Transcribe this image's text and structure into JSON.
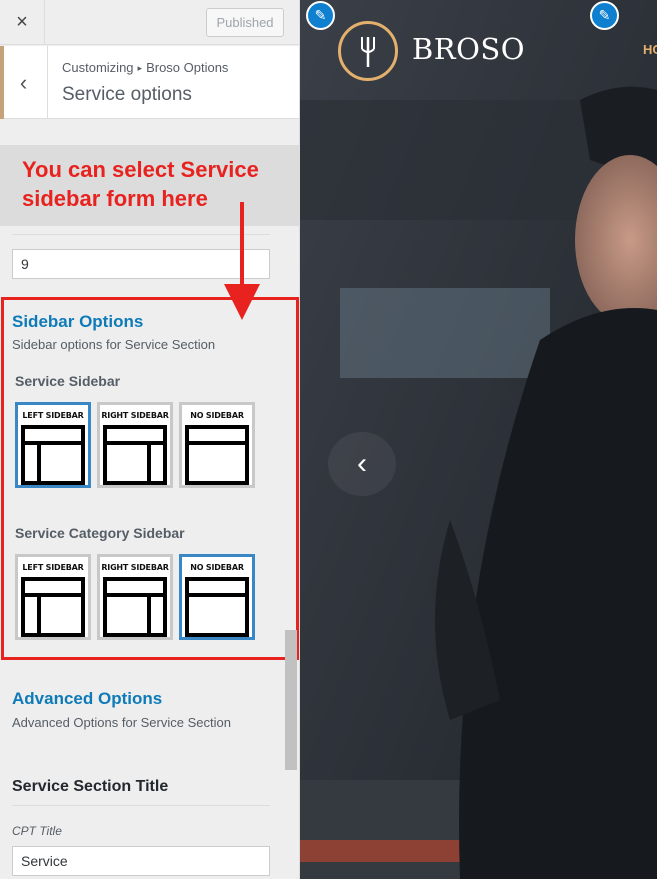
{
  "topbar": {
    "close_icon": "×",
    "published_label": "Published"
  },
  "header": {
    "breadcrumb_root": "Customizing",
    "breadcrumb_sep": "▸",
    "breadcrumb_parent": "Broso Options",
    "title": "Service options",
    "back_icon": "‹"
  },
  "callout": {
    "text": "You can select Service sidebar form here"
  },
  "items_input": {
    "value": "9"
  },
  "sidebar_options": {
    "title": "Sidebar Options",
    "description": "Sidebar options for Service Section",
    "service_sidebar": {
      "label": "Service Sidebar",
      "options": [
        "LEFT SIDEBAR",
        "RIGHT SIDEBAR",
        "NO SIDEBAR"
      ],
      "selected": "LEFT SIDEBAR"
    },
    "service_category_sidebar": {
      "label": "Service Category Sidebar",
      "options": [
        "LEFT SIDEBAR",
        "RIGHT SIDEBAR",
        "NO SIDEBAR"
      ],
      "selected": "NO SIDEBAR"
    }
  },
  "advanced_options": {
    "title": "Advanced Options",
    "description": "Advanced Options for Service Section"
  },
  "section_title": {
    "heading": "Service Section Title",
    "cpt_label": "CPT Title",
    "cpt_value": "Service"
  },
  "preview": {
    "logo_text": "BROSO",
    "nav_peek": "HO",
    "edit_icon": "pencil-icon",
    "prev_icon": "‹",
    "colors": {
      "accent": "#e4b06d",
      "edit_blue": "#0f7fd0",
      "annotation_red": "#e8231f",
      "link_blue": "#0e7bb8"
    }
  }
}
